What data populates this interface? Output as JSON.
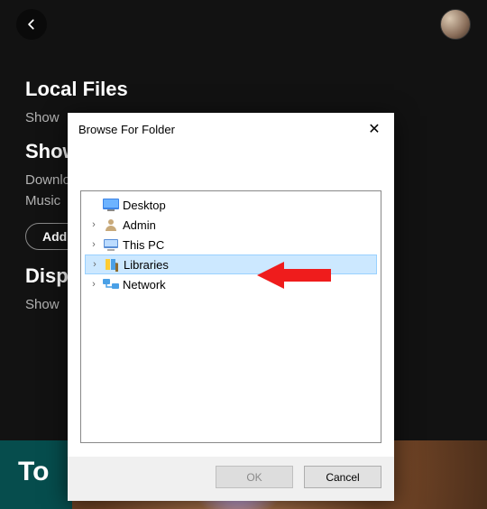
{
  "header": {
    "back": "‹"
  },
  "sections": {
    "localFiles": {
      "title": "Local Files",
      "show": "Show"
    },
    "showFrom": {
      "title": "Show",
      "downloads": "Downloads",
      "music": "Music"
    },
    "addBtn": "Add",
    "display": {
      "title": "Disp",
      "show": "Show"
    }
  },
  "bottom": {
    "toc": "To"
  },
  "dialog": {
    "title": "Browse For Folder",
    "close": "✕",
    "tree": {
      "desktop": "Desktop",
      "admin": "Admin",
      "thispc": "This PC",
      "libraries": "Libraries",
      "network": "Network"
    },
    "ok": "OK",
    "cancel": "Cancel"
  }
}
